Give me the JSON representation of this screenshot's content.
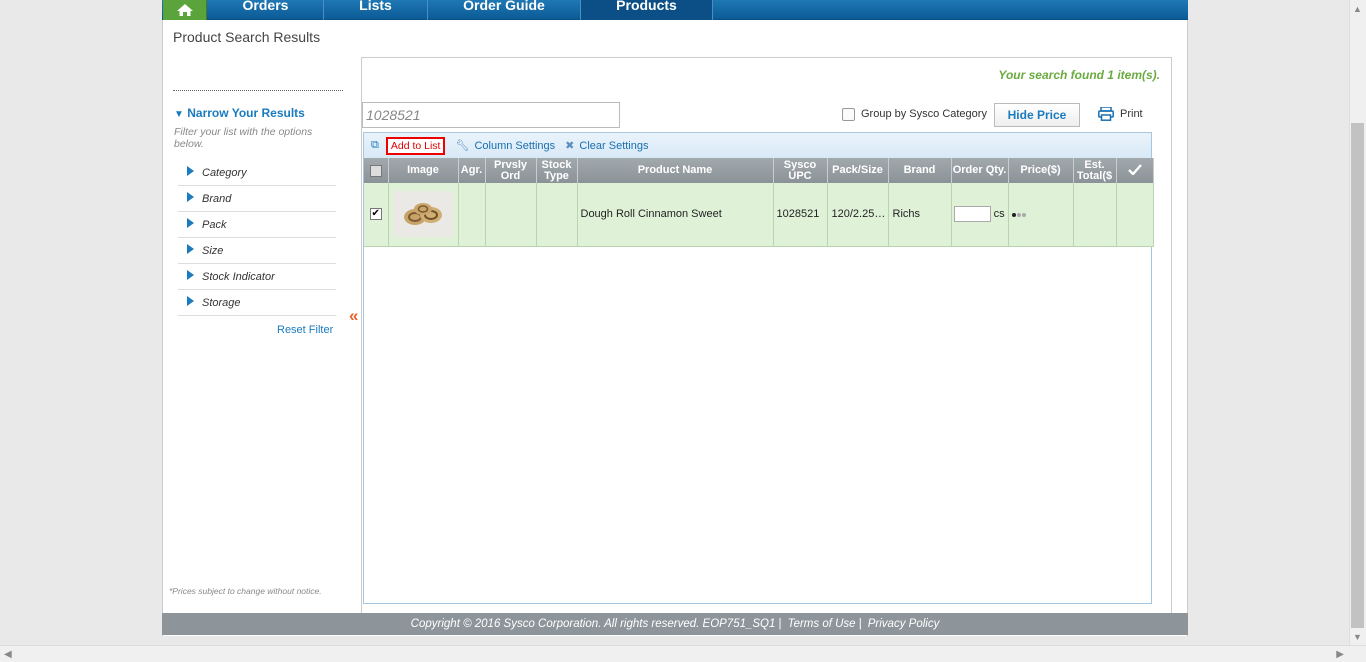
{
  "nav": {
    "tabs": [
      {
        "label": "Orders"
      },
      {
        "label": "Lists"
      },
      {
        "label": "Order Guide"
      },
      {
        "label": "Products"
      }
    ],
    "active": "Products"
  },
  "page_title": "Product Search Results",
  "sidebar": {
    "title": "Narrow Your Results",
    "description": "Filter your list with the options below.",
    "filters": [
      "Category",
      "Brand",
      "Pack",
      "Size",
      "Stock Indicator",
      "Storage"
    ],
    "reset_label": "Reset Filter",
    "price_note": "*Prices subject to change without notice."
  },
  "search": {
    "found_text": "Your search found 1 item(s).",
    "query": "1028521",
    "group_by_label": "Group by Sysco Category",
    "group_by_checked": false,
    "hide_price_label": "Hide Price",
    "print_label": "Print"
  },
  "toolbar": {
    "add_to_list_label": "Add to List",
    "column_settings_label": "Column Settings",
    "clear_settings_label": "Clear Settings"
  },
  "grid": {
    "columns": [
      {
        "key": "select",
        "label": ""
      },
      {
        "key": "image",
        "label": "Image"
      },
      {
        "key": "agr",
        "label": "Agr."
      },
      {
        "key": "prvsly",
        "label": "Prvsly Ord"
      },
      {
        "key": "stock",
        "label": "Stock Type"
      },
      {
        "key": "name",
        "label": "Product Name"
      },
      {
        "key": "upc",
        "label": "Sysco UPC"
      },
      {
        "key": "pack",
        "label": "Pack/Size"
      },
      {
        "key": "brand",
        "label": "Brand"
      },
      {
        "key": "qty",
        "label": "Order Qty."
      },
      {
        "key": "price",
        "label": "Price($)"
      },
      {
        "key": "total",
        "label": "Est. Total($"
      },
      {
        "key": "check",
        "label": ""
      }
    ],
    "rows": [
      {
        "selected": true,
        "image_icon": "cinnamon-roll-photo",
        "agr": "",
        "prvsly": "",
        "stock": "",
        "name": "Dough Roll Cinnamon Sweet",
        "upc": "1028521",
        "pack": "120/2.25…",
        "brand": "Richs",
        "qty_value": "",
        "qty_unit": "cs",
        "price": "",
        "total": ""
      }
    ]
  },
  "footer": {
    "copyright": "Copyright © 2016 Sysco Corporation. All rights reserved. EOP751_SQ1",
    "terms": "Terms of Use",
    "privacy": "Privacy Policy"
  },
  "colors": {
    "nav_blue": "#0b5b96",
    "home_green": "#5ba33b",
    "link_blue": "#1a7bbf",
    "found_green": "#6aab3f",
    "row_green": "#dff2d8",
    "accent_orange": "#e8652a"
  }
}
